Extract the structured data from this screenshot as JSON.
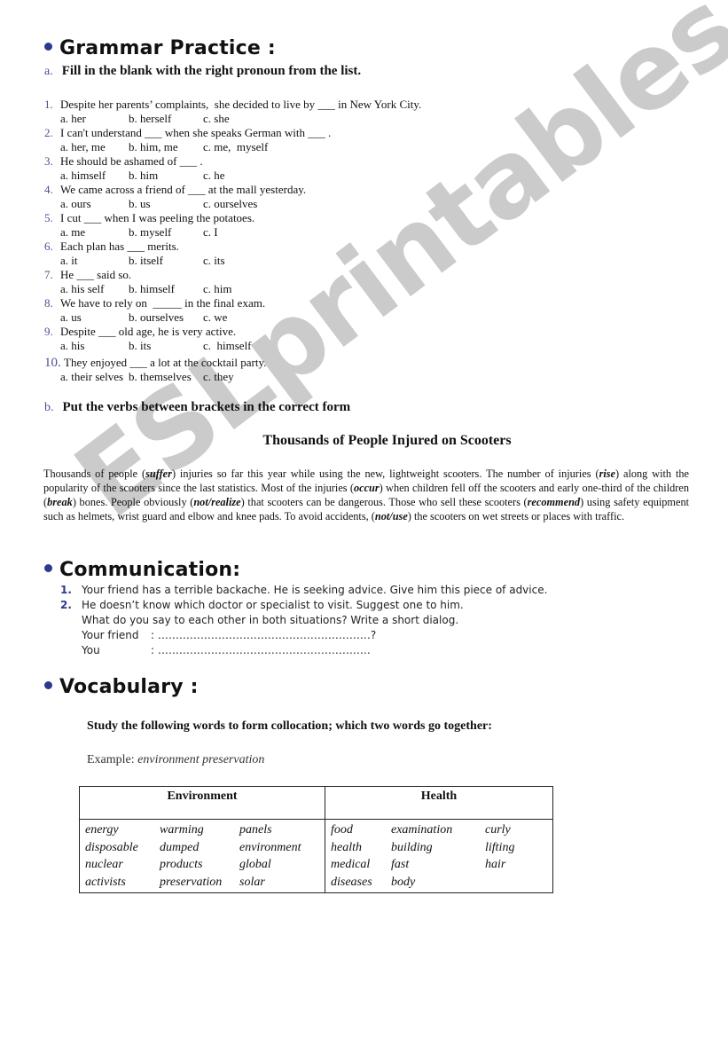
{
  "grammar": {
    "heading": "Grammar Practice :",
    "part_a": {
      "label": "a.",
      "instruction": "Fill in the blank with the right pronoun from the list."
    },
    "questions": [
      {
        "num": "1.",
        "text": "Despite her parents’ complaints,  she decided to live by ___ in New York City.",
        "options": [
          "a. her",
          "b. herself",
          "c. she"
        ]
      },
      {
        "num": "2.",
        "text": "I can't understand ___ when she speaks German with ___ .",
        "options": [
          "a. her, me",
          "b. him, me",
          "c. me,  myself"
        ]
      },
      {
        "num": "3.",
        "text": "He should be ashamed of ___ .",
        "options": [
          "a. himself",
          "b. him",
          "c. he"
        ]
      },
      {
        "num": "4.",
        "text": "We came across a friend of ___ at the mall yesterday.",
        "options": [
          "a. ours",
          "b. us",
          "c. ourselves"
        ]
      },
      {
        "num": "5.",
        "text": "I cut ___ when I was peeling the potatoes.",
        "options": [
          "a. me",
          "b. myself",
          "c. I"
        ]
      },
      {
        "num": "6.",
        "text": "Each plan has ___ merits.",
        "options": [
          "a. it",
          "b. itself",
          "c. its"
        ]
      },
      {
        "num": "7.",
        "text": "He ___ said so.",
        "options": [
          "a. his self",
          "b. himself",
          "c. him"
        ]
      },
      {
        "num": "8.",
        "text": "We have to rely on  _____ in the final exam.",
        "options": [
          "a. us",
          "b. ourselves",
          "c. we"
        ]
      },
      {
        "num": "9.",
        "text": "Despite ___ old age, he is very active.",
        "options": [
          "a. his",
          "b. its",
          "c.  himself"
        ]
      },
      {
        "num": "10.",
        "text": "They enjoyed ___ a lot at the cocktail party.",
        "options": [
          "a. their selves",
          "b. themselves",
          "c. they"
        ]
      }
    ],
    "part_b": {
      "label": "b.",
      "instruction": "Put the verbs between brackets in the correct form"
    },
    "story": {
      "title": "Thousands of People Injured on Scooters",
      "segments": [
        {
          "t": "Thousands of people ("
        },
        {
          "v": "suffer"
        },
        {
          "t": ") injuries so far this year while using the new, lightweight scooters. The number of injuries ("
        },
        {
          "v": "rise"
        },
        {
          "t": ") along with the popularity of the scooters since the last statistics. Most of the injuries ("
        },
        {
          "v": "occur"
        },
        {
          "t": ") when children fell off the scooters and early one-third of the children ("
        },
        {
          "v": "break"
        },
        {
          "t": ") bones. People obviously ("
        },
        {
          "v": "not/realize"
        },
        {
          "t": ") that scooters can be dangerous. Those who sell these scooters ("
        },
        {
          "v": "recommend"
        },
        {
          "t": ") using safety equipment such as helmets, wrist guard and elbow and knee pads. To avoid accidents, ("
        },
        {
          "v": "not/use"
        },
        {
          "t": ") the scooters on wet streets or places with traffic."
        }
      ]
    }
  },
  "communication": {
    "heading": "Communication:",
    "items": [
      {
        "num": "1.",
        "text": "Your friend has a terrible backache.  He is seeking advice.  Give him this piece of advice."
      },
      {
        "num": "2.",
        "text": "He doesn’t know which doctor or specialist to visit. Suggest one to him."
      }
    ],
    "prompt": "What do you say to each other in both situations? Write a short dialog.",
    "dialog": [
      {
        "speaker": "Your friend",
        "line": ": ……………………………………………………?"
      },
      {
        "speaker": "You",
        "line": ": ……………………………………………………"
      }
    ]
  },
  "vocabulary": {
    "heading": "Vocabulary :",
    "instruction": "Study the following words to form collocation; which two words go together:",
    "example_label": "Example:",
    "example_value": "environment preservation",
    "table": {
      "headers": [
        "Environment",
        "Health"
      ],
      "environment_rows": [
        [
          "energy",
          "warming",
          "panels"
        ],
        [
          "disposable",
          "dumped",
          "environment"
        ],
        [
          "nuclear",
          "products",
          "global"
        ],
        [
          "activists",
          "preservation",
          "solar"
        ]
      ],
      "health_rows": [
        [
          "food",
          "examination",
          "curly"
        ],
        [
          "health",
          "building",
          "lifting"
        ],
        [
          "medical",
          "fast",
          "hair"
        ],
        [
          "diseases",
          "body",
          ""
        ]
      ]
    }
  },
  "watermark": "ESLprintables.com"
}
